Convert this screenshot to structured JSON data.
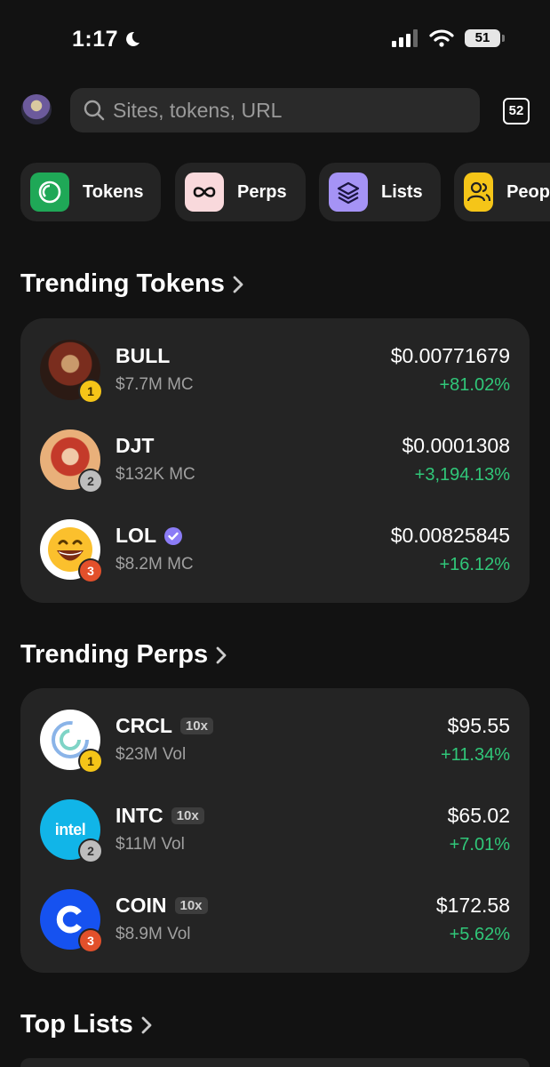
{
  "status": {
    "time": "1:17",
    "battery": "51"
  },
  "search": {
    "placeholder": "Sites, tokens, URL"
  },
  "tab_count": "52",
  "chips": [
    {
      "label": "Tokens",
      "icon": "tokens-icon",
      "color": "#1fa857"
    },
    {
      "label": "Perps",
      "icon": "infinity-icon",
      "color": "#f9d9dc"
    },
    {
      "label": "Lists",
      "icon": "layers-icon",
      "color": "#a593f5"
    },
    {
      "label": "Peop",
      "icon": "people-icon",
      "color": "#f5c518"
    }
  ],
  "trending_tokens": {
    "title": "Trending Tokens",
    "items": [
      {
        "rank": "1",
        "symbol": "BULL",
        "sub": "$7.7M MC",
        "price": "$0.00771679",
        "change": "+81.02%"
      },
      {
        "rank": "2",
        "symbol": "DJT",
        "sub": "$132K MC",
        "price": "$0.0001308",
        "change": "+3,194.13%"
      },
      {
        "rank": "3",
        "symbol": "LOL",
        "sub": "$8.2M MC",
        "price": "$0.00825845",
        "change": "+16.12%",
        "verified": true
      }
    ]
  },
  "trending_perps": {
    "title": "Trending Perps",
    "items": [
      {
        "rank": "1",
        "symbol": "CRCL",
        "leverage": "10x",
        "sub": "$23M Vol",
        "price": "$95.55",
        "change": "+11.34%"
      },
      {
        "rank": "2",
        "symbol": "INTC",
        "leverage": "10x",
        "sub": "$11M Vol",
        "price": "$65.02",
        "change": "+7.01%",
        "logo_text": "intel"
      },
      {
        "rank": "3",
        "symbol": "COIN",
        "leverage": "10x",
        "sub": "$8.9M Vol",
        "price": "$172.58",
        "change": "+5.62%"
      }
    ]
  },
  "top_lists": {
    "title": "Top Lists"
  },
  "colors": {
    "background": "#121212",
    "card": "#242424",
    "positive": "#30c779"
  }
}
